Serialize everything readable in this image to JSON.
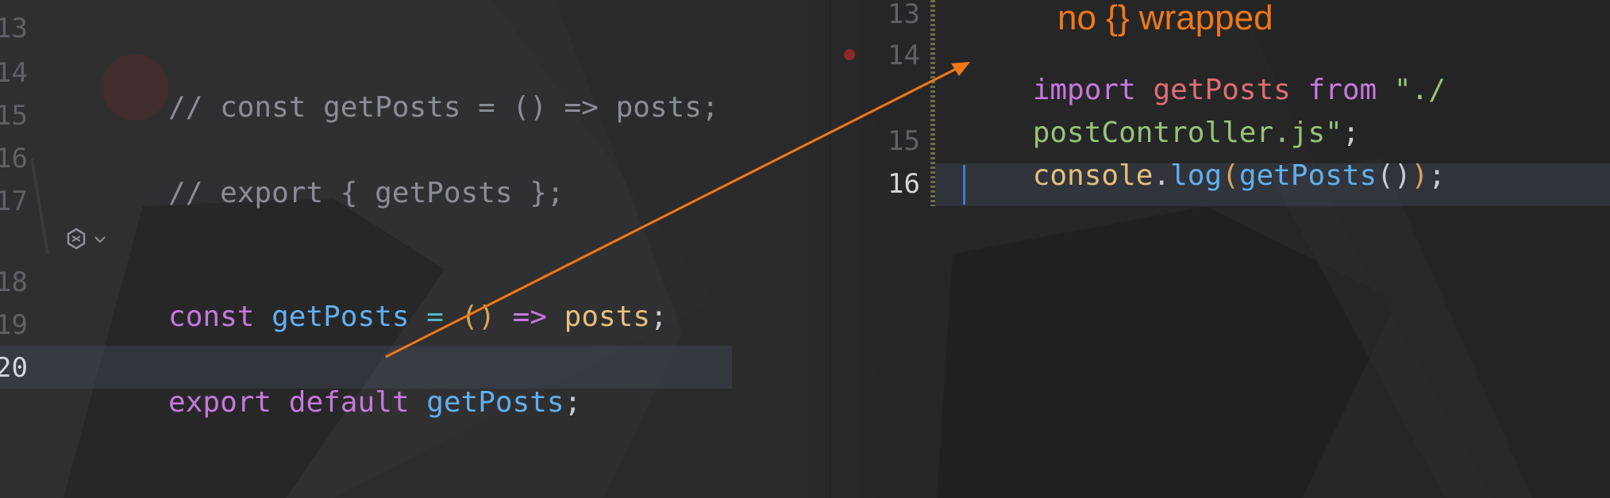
{
  "annotation": {
    "text": "no {} wrapped",
    "color": "#f07818"
  },
  "left_editor": {
    "line_numbers": [
      "13",
      "14",
      "15",
      "16",
      "17",
      "18",
      "19",
      "20"
    ],
    "lines": {
      "l14": {
        "comment": "// const getPosts = () => posts;"
      },
      "l16": {
        "comment": "// export { getPosts };"
      },
      "l18": {
        "kw": "const",
        "fn": "getPosts",
        "op1": "=",
        "parens": "()",
        "op2": "=>",
        "var": "posts",
        "end": ";"
      },
      "l20": {
        "kw1": "export",
        "kw2": "default",
        "fn": "getPosts",
        "end": ";"
      }
    }
  },
  "right_editor": {
    "line_numbers": [
      "13",
      "14",
      "15",
      "16"
    ],
    "lines": {
      "l14a": {
        "kw1": "import",
        "ident": "getPosts",
        "kw2": "from",
        "str1": "\"./"
      },
      "l14b": {
        "str2": "postController.js\"",
        "end": ";"
      },
      "l15": {
        "obj": "console",
        "dot": ".",
        "method": "log",
        "p1": "(",
        "fn": "getPosts",
        "p2": "()",
        "p3": ")",
        "end": ";"
      }
    }
  }
}
